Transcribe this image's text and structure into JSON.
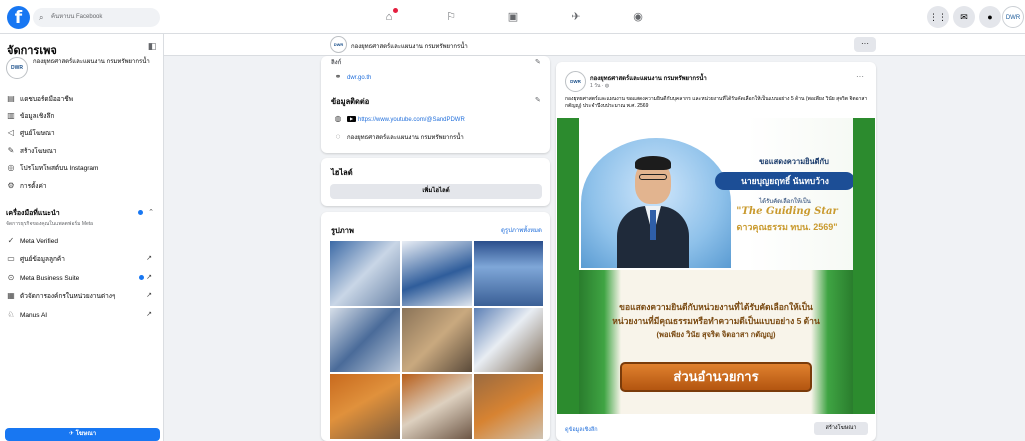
{
  "topbar": {
    "logo": "f",
    "search_placeholder": "ค้นหาบน Facebook"
  },
  "sidebar": {
    "title": "จัดการเพจ",
    "page_name": "กองยุทธศาสตร์และแผนงาน กรมทรัพยากรน้ำ",
    "items": [
      {
        "label": "แดชบอร์ดมืออาชีพ"
      },
      {
        "label": "ข้อมูลเชิงลึก"
      },
      {
        "label": "ศูนย์โฆษณา"
      },
      {
        "label": "สร้างโฆษณา"
      },
      {
        "label": "โปรโมทโพสต์บน Instagram"
      },
      {
        "label": "การตั้งค่า"
      }
    ],
    "tools_title": "เครื่องมือที่แนะนำ",
    "tools_subtitle": "จัดการธุรกิจของคุณในแพลตฟอร์ม Meta",
    "tools": [
      {
        "label": "Meta Verified"
      },
      {
        "label": "ศูนย์ข้อมูลลูกค้า"
      },
      {
        "label": "Meta Business Suite"
      },
      {
        "label": "ตัวจัดการองค์กรในหน่วยงานต่างๆ"
      },
      {
        "label": "Manus AI"
      }
    ],
    "cta": "โฆษณา"
  },
  "page_header": {
    "title": "กองยุทธศาสตร์และแผนงาน กรมทรัพยากรน้ำ",
    "more": "···"
  },
  "info_card": {
    "top_label": "ลิงก์",
    "website": "dwr.go.th",
    "contact_title": "ข้อมูลติดต่อ",
    "youtube": "https://www.youtube.com/@SandPDWR",
    "messenger": "กองยุทธศาสตร์และแผนงาน กรมทรัพยากรน้ำ"
  },
  "featured_card": {
    "title": "ไฮไลต์",
    "button": "เพิ่มไฮไลต์"
  },
  "photos_card": {
    "title": "รูปภาพ",
    "see_all": "ดูรูปภาพทั้งหมด"
  },
  "post": {
    "author": "กองยุทธศาสตร์และแผนงาน กรมทรัพยากรน้ำ",
    "time": "1 วัน · ",
    "text": "กองยุทธศาสตร์และแผนงาน ขอแสดงความยินดีกับบุคลากร และหน่วยงานที่ได้รับคัดเลือกให้เป็นแบบอย่าง 5 ด้าน (พอเพียง วินัย สุจริต จิตอาสา กตัญญู) ประจำปีงบประมาณ พ.ศ. 2569",
    "banner": {
      "congrats": "ขอแสดงความยินดีกับ",
      "name": "นายบุญยฤทธิ์ นันทบว้าง",
      "chosen": "ได้รับคัดเลือกให้เป็น",
      "guiding": "\"The Guiding Star",
      "star": "ดาวคุณธรรม ทบน. 2569\"",
      "line1": "ขอแสดงความยินดีกับหน่วยงานที่ได้รับคัดเลือกให้เป็น",
      "line2": "หน่วยงานที่มีคุณธรรมหรือทำความดีเป็นแบบอย่าง 5 ด้าน",
      "line3": "(พอเพียง วินัย สุจริต จิตอาสา กตัญญู)",
      "plate": "ส่วนอำนวยการ"
    },
    "insights_link": "ดูข้อมูลเชิงลึก",
    "boost": "สร้างโฆษณา"
  }
}
